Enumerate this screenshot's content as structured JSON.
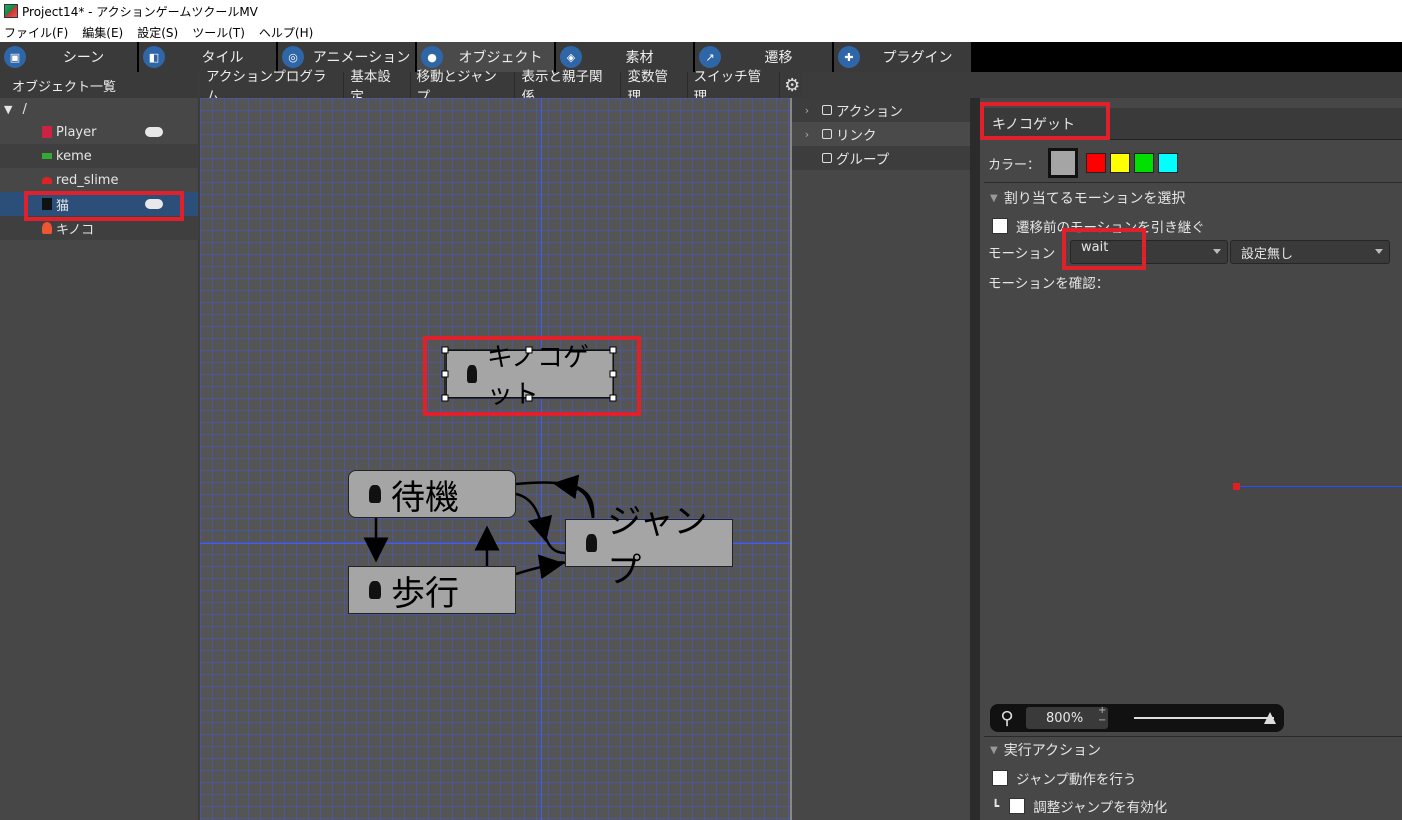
{
  "window": {
    "title": "Project14* - アクションゲームツクールMV"
  },
  "menu": [
    "ファイル(F)",
    "編集(E)",
    "設定(S)",
    "ツール(T)",
    "ヘルプ(H)"
  ],
  "tabs": [
    {
      "label": "シーン",
      "icon": "scene-icon"
    },
    {
      "label": "タイル",
      "icon": "tile-icon"
    },
    {
      "label": "アニメーション",
      "icon": "animation-icon"
    },
    {
      "label": "オブジェクト",
      "icon": "object-icon",
      "active": true
    },
    {
      "label": "素材",
      "icon": "material-icon"
    },
    {
      "label": "遷移",
      "icon": "transition-icon"
    },
    {
      "label": "プラグイン",
      "icon": "plugin-icon"
    }
  ],
  "object_list": {
    "header": "オブジェクト一覧",
    "root": "/",
    "items": [
      {
        "name": "Player",
        "controller": true
      },
      {
        "name": "keme"
      },
      {
        "name": "red_slime"
      },
      {
        "name": "猫",
        "controller": true,
        "selected": true
      },
      {
        "name": "キノコ"
      }
    ]
  },
  "center_tabs": [
    "アクションプログラム",
    "基本設定",
    "移動とジャンプ",
    "表示と親子関係",
    "変数管理",
    "スイッチ管理"
  ],
  "nodes": {
    "selected": "キノコゲット",
    "wait": "待機",
    "walk": "歩行",
    "jump": "ジャンプ"
  },
  "action_tree": {
    "items": [
      "アクション",
      "リンク",
      "グループ"
    ]
  },
  "props": {
    "name": "キノコゲット",
    "color_label": "カラー：",
    "colors": [
      "#a5a5a5",
      "#ff0000",
      "#ffff00",
      "#00e000",
      "#00ffff"
    ],
    "motion_section": "割り当てるモーションを選択",
    "inherit_label": "遷移前のモーションを引き継ぐ",
    "motion_label": "モーション",
    "motion_value": "wait",
    "motion_sub_value": "設定無し",
    "confirm_label": "モーションを確認：",
    "zoom": "800%",
    "exec_section": "実行アクション",
    "jump_label": "ジャンプ動作を行う",
    "adjust_prefix": "┗",
    "adjust_label": "調整ジャンプを有効化"
  },
  "colors": {
    "highlight_red": "#e0202a",
    "selection_blue": "#2c4f7a",
    "grid_blue": "#3f5bff"
  }
}
